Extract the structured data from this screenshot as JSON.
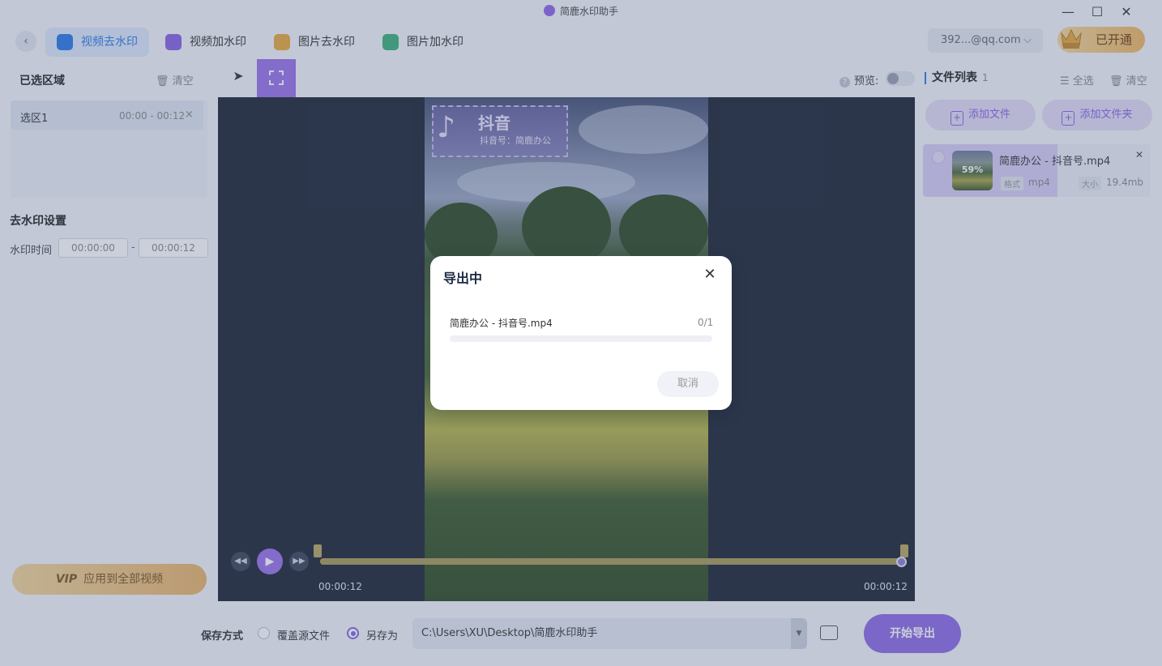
{
  "window": {
    "title": "简鹿水印助手",
    "controls": {
      "minimize": "—",
      "maximize": "☐",
      "close": "✕"
    }
  },
  "nav": {
    "back": "‹",
    "tabs": [
      {
        "label": "视频去水印",
        "active": true,
        "icon": "video-remove-icon",
        "color": "#2b79e8"
      },
      {
        "label": "视频加水印",
        "active": false,
        "icon": "video-add-icon",
        "color": "#8a62e3"
      },
      {
        "label": "图片去水印",
        "active": false,
        "icon": "image-remove-icon",
        "color": "#e8a93b"
      },
      {
        "label": "图片加水印",
        "active": false,
        "icon": "image-add-icon",
        "color": "#3db07a"
      }
    ],
    "account": "392...@qq.com",
    "account_chevron": "⌵",
    "vip_button": "已开通"
  },
  "left": {
    "selected_title": "已选区域",
    "clear_label": "清空",
    "regions": [
      {
        "name": "选区1",
        "time": "00:00 - 00:12",
        "remove": "×"
      }
    ],
    "settings_title": "去水印设置",
    "time_label": "水印时间",
    "time_start": "00:00:00",
    "time_end": "00:00:12",
    "time_separator": "-",
    "vip_tag": "VIP",
    "apply_all": "应用到全部视频"
  },
  "tools": {
    "preview_help": "?",
    "preview_label": "预览:",
    "preview_on": false
  },
  "player": {
    "watermark_title": "抖音",
    "watermark_sub": "抖音号：简鹿办公",
    "start_time": "00:00:12",
    "end_time": "00:00:12",
    "rewind": "◀◀",
    "play": "▶",
    "forward": "▶▶",
    "progress": 1.0
  },
  "right": {
    "title": "文件列表",
    "count": "1",
    "select_all": "全选",
    "clear": "清空",
    "add_file": "添加文件",
    "add_folder": "添加文件夹",
    "files": [
      {
        "name": "简鹿办公 - 抖音号.mp4",
        "progress_text": "59%",
        "progress": 0.59,
        "format_tag": "格式",
        "format": "mp4",
        "size_tag": "大小",
        "size": "19.4mb",
        "remove": "✕"
      }
    ]
  },
  "bottom": {
    "save_mode_label": "保存方式",
    "overwrite_label": "覆盖源文件",
    "save_as_label": "另存为",
    "save_as_selected": true,
    "path": "C:\\Users\\XU\\Desktop\\简鹿水印助手",
    "dropdown": "▼",
    "start_export": "开始导出"
  },
  "modal": {
    "title": "导出中",
    "close": "✕",
    "file_name": "简鹿办公 - 抖音号.mp4",
    "count": "0/1",
    "progress": 0.0,
    "cancel": "取消"
  },
  "colors": {
    "accent_purple": "#8f6ae6",
    "accent_blue": "#2b79e8",
    "vip_gold": "#f0b660"
  }
}
